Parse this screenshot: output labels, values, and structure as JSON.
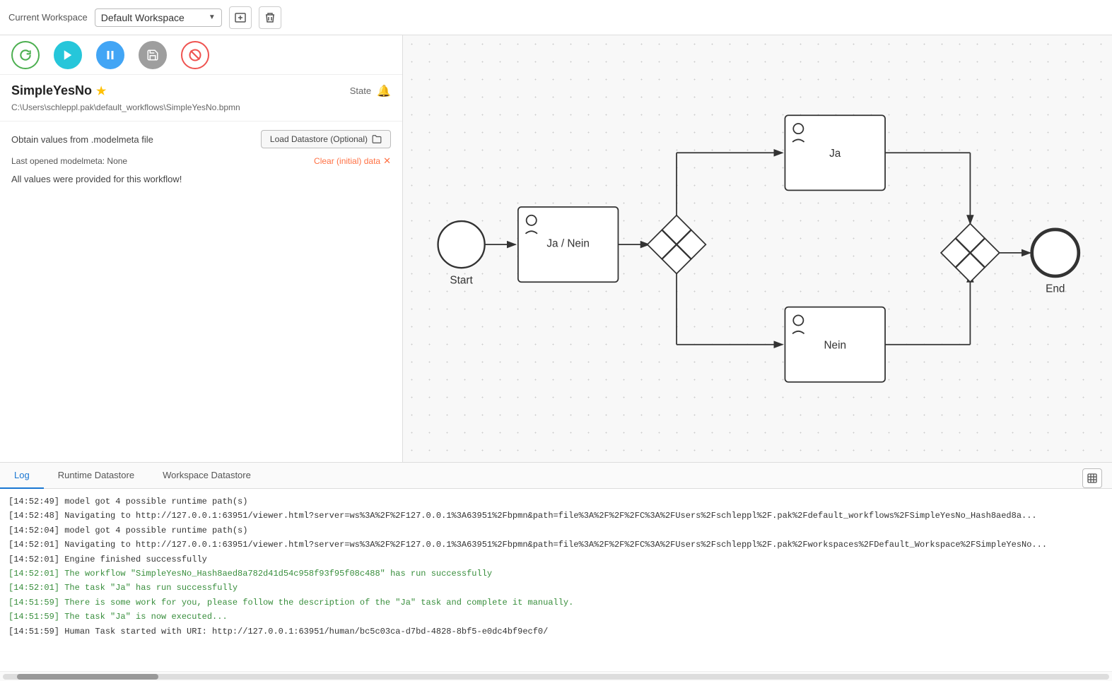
{
  "topbar": {
    "current_workspace_label": "Current Workspace",
    "workspace_name": "Default Workspace",
    "add_icon": "+",
    "delete_icon": "🗑"
  },
  "toolbar": {
    "refresh_title": "Refresh",
    "run_title": "Run",
    "pause_title": "Pause",
    "save_title": "Save",
    "stop_title": "Stop"
  },
  "workflow": {
    "name": "SimpleYesNo",
    "state_label": "State",
    "path": "C:\\Users\\schleppl.pak\\default_workflows\\SimpleYesNo.bpmn",
    "obtain_label": "Obtain values from .modelmeta file",
    "load_datastore_label": "Load Datastore (Optional)",
    "last_opened_label": "Last opened modelmeta: None",
    "clear_label": "Clear (initial) data",
    "values_status": "All values were provided for this workflow!"
  },
  "tabs": {
    "log_label": "Log",
    "runtime_label": "Runtime Datastore",
    "workspace_label": "Workspace Datastore"
  },
  "log": {
    "lines": [
      {
        "text": "[14:52:49] model got 4 possible runtime path(s)",
        "type": "normal"
      },
      {
        "text": "[14:52:48] Navigating to http://127.0.0.1:63951/viewer.html?server=ws%3A%2F%2F127.0.0.1%3A63951%2Fbpmn&path=file%3A%2F%2F%2FC%3A%2FUsers%2Fschleppl%2F.pak%2Fdefault_workflows%2FSimpleYesNo_Hash8aed8a...",
        "type": "normal"
      },
      {
        "text": "[14:52:04] model got 4 possible runtime path(s)",
        "type": "normal"
      },
      {
        "text": "[14:52:01] Navigating to http://127.0.0.1:63951/viewer.html?server=ws%3A%2F%2F127.0.0.1%3A63951%2Fbpmn&path=file%3A%2F%2F%2FC%3A%2FUsers%2Fschleppl%2F.pak%2Fworkspaces%2FDefault_Workspace%2FSimpleYesNo...",
        "type": "normal"
      },
      {
        "text": "[14:52:01] Engine finished successfully",
        "type": "normal"
      },
      {
        "text": "[14:52:01] The workflow \"SimpleYesNo_Hash8aed8a782d41d54c958f93f95f08c488\" has run successfully",
        "type": "success"
      },
      {
        "text": "[14:52:01] The task \"Ja\" has run successfully",
        "type": "success"
      },
      {
        "text": "[14:51:59] There is some work for you, please follow the description of the \"Ja\" task and complete it manually.",
        "type": "success"
      },
      {
        "text": "[14:51:59] The task \"Ja\" is now executed...",
        "type": "success"
      },
      {
        "text": "[14:51:59] Human Task started with URI: http://127.0.0.1:63951/human/bc5c03ca-d7bd-4828-8bf5-e0dc4bf9ecf0/",
        "type": "normal"
      }
    ]
  },
  "diagram": {
    "start_label": "Start",
    "end_label": "End",
    "task_ja_nein_label": "Ja / Nein",
    "task_ja_label": "Ja",
    "task_nein_label": "Nein"
  },
  "colors": {
    "accent_blue": "#1976D2",
    "success_green": "#388E3C",
    "teal": "#26C6DA",
    "light_blue": "#42A5F5",
    "orange_red": "#FF7043",
    "gray": "#9E9E9E",
    "star_yellow": "#FFC107",
    "bell_blue": "#4FC3F7"
  }
}
